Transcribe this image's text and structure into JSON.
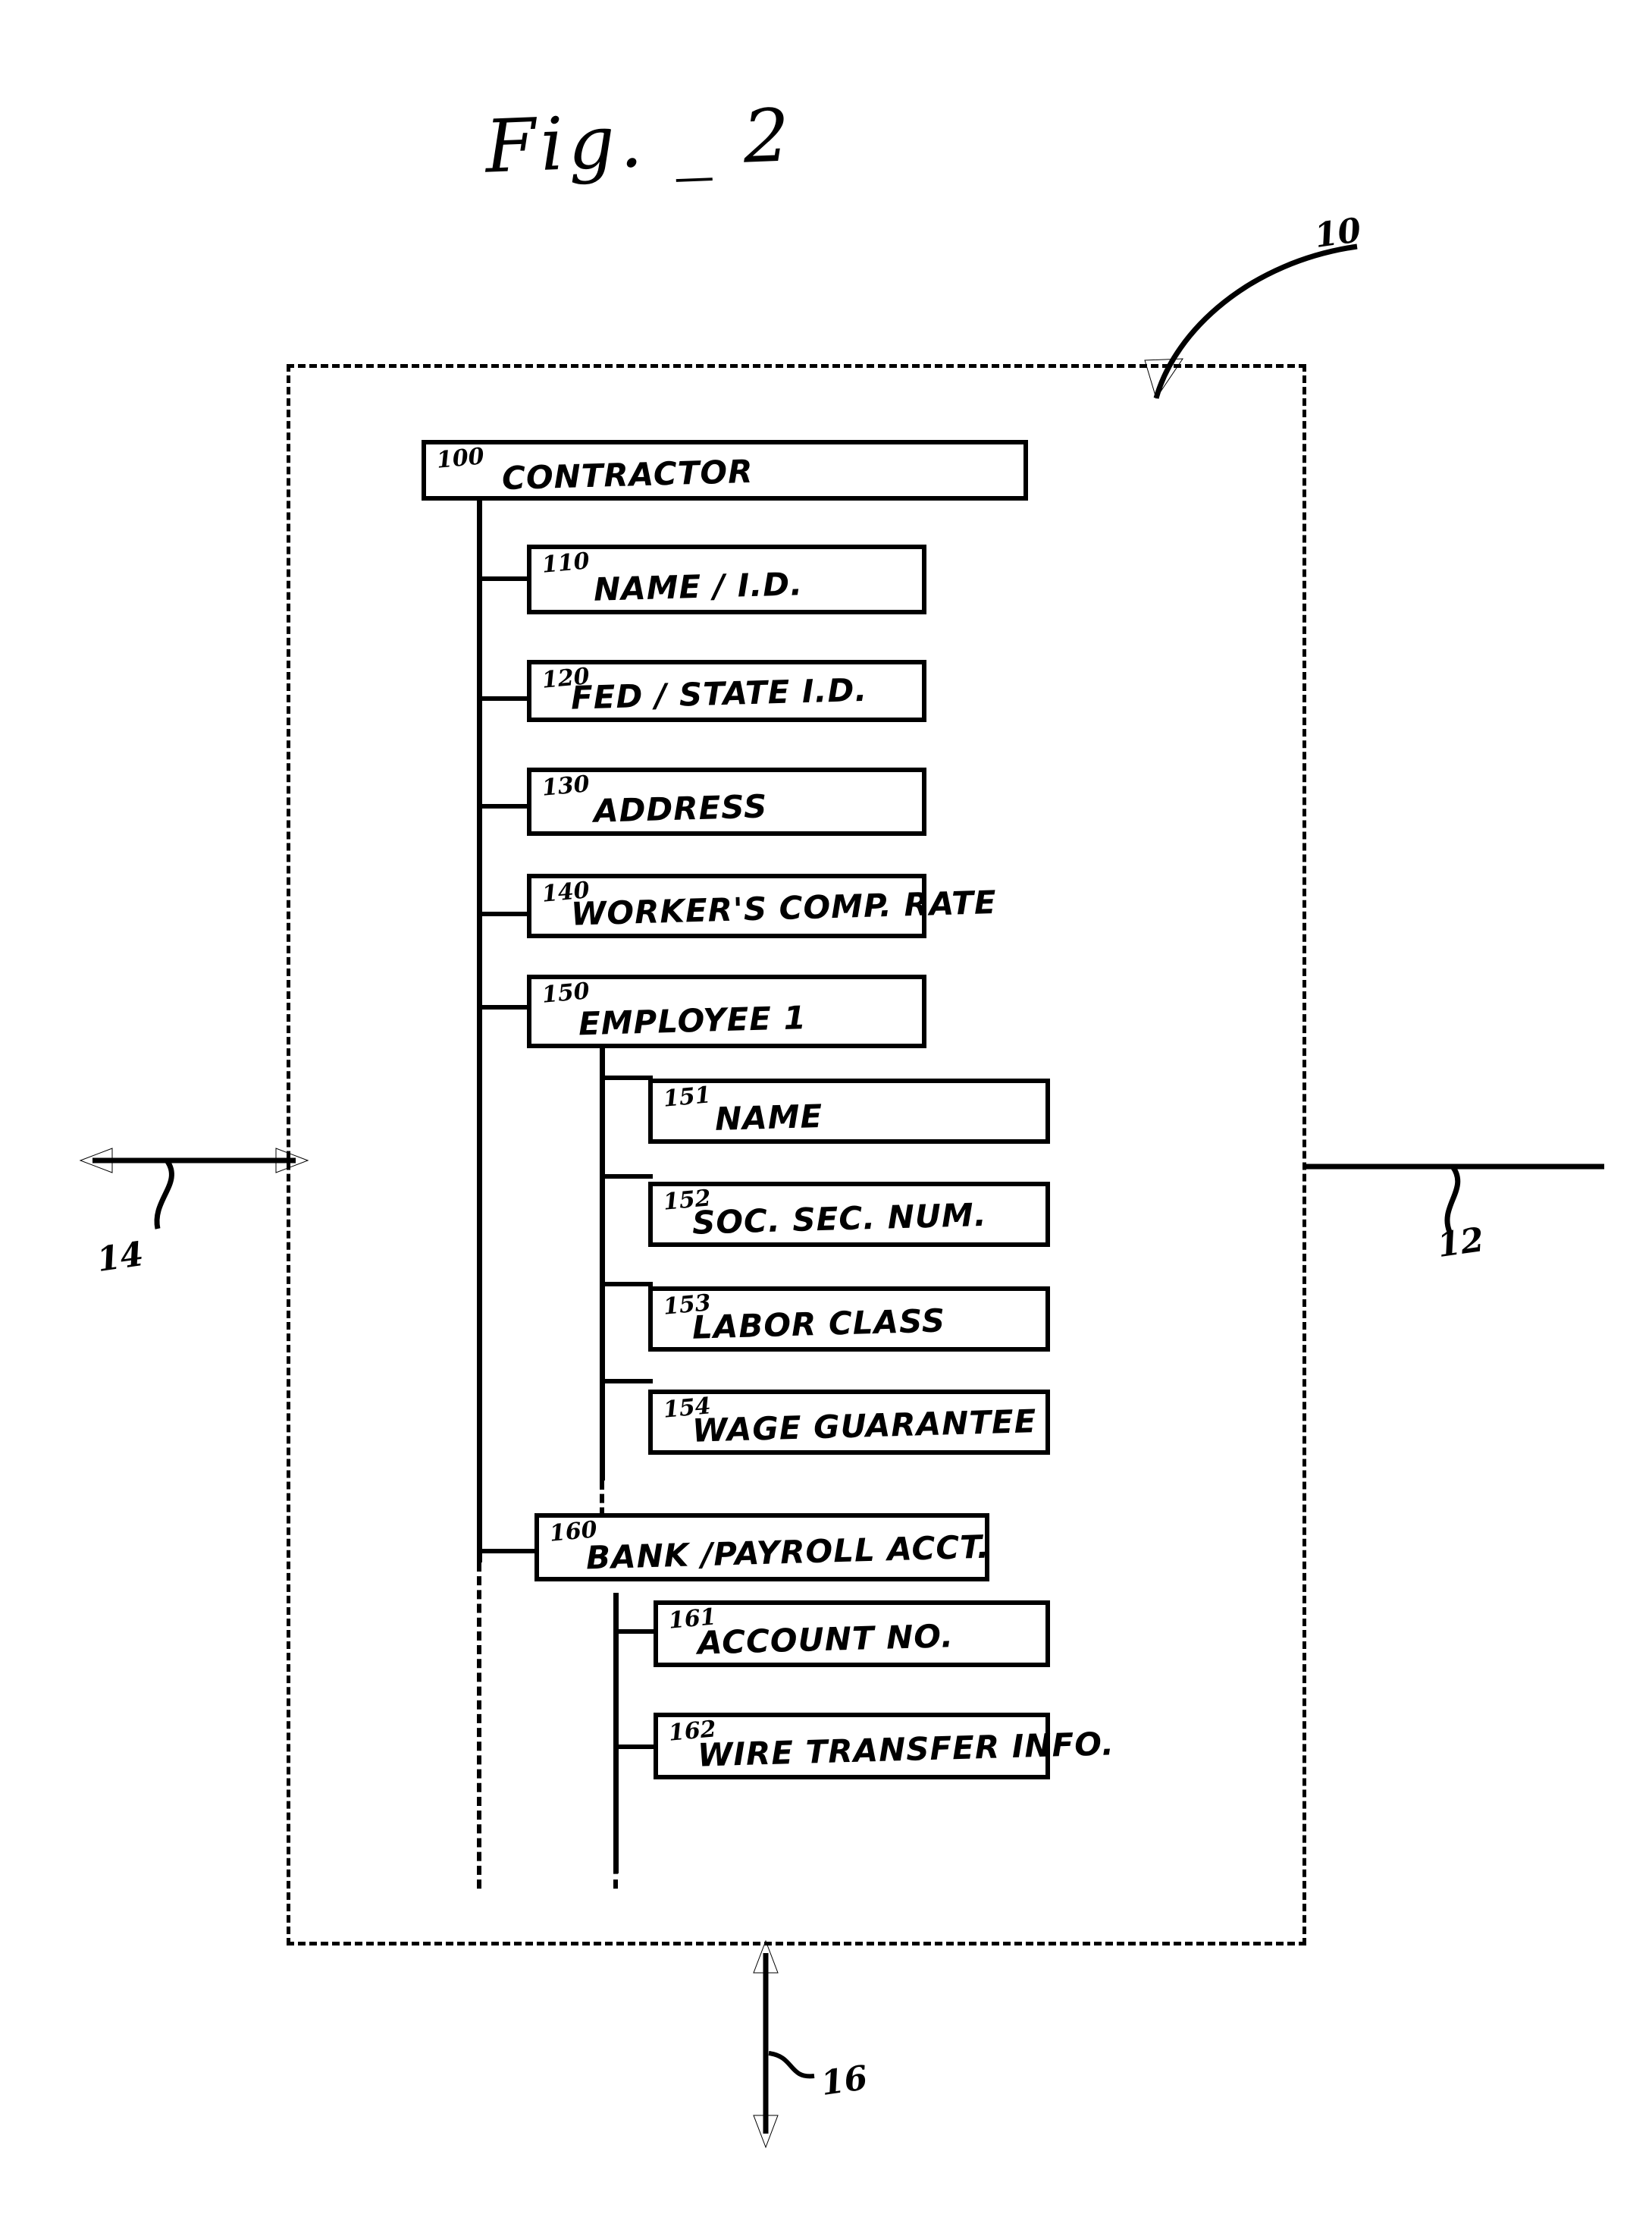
{
  "figure": {
    "title": "Fig. _ 2"
  },
  "boundary": {
    "name": "system-boundary",
    "style": "dashed"
  },
  "callouts": [
    {
      "id": "10",
      "label": "10",
      "position": "top-right",
      "leader": "curved-arrow-to-boundary-corner"
    },
    {
      "id": "12",
      "label": "12",
      "position": "right",
      "leader": "horizontal-line-right"
    },
    {
      "id": "14",
      "label": "14",
      "position": "left",
      "leader": "double-headed-horizontal-arrow"
    },
    {
      "id": "16",
      "label": "16",
      "position": "bottom",
      "leader": "double-headed-vertical-arrow"
    }
  ],
  "nodes": [
    {
      "ref": "100",
      "label": "CONTRACTOR",
      "level": 0
    },
    {
      "ref": "110",
      "label": "NAME / I.D.",
      "level": 1
    },
    {
      "ref": "120",
      "label": "FED / STATE  I.D.",
      "level": 1
    },
    {
      "ref": "130",
      "label": "ADDRESS",
      "level": 1
    },
    {
      "ref": "140",
      "label": "WORKER'S COMP. RATE",
      "level": 1
    },
    {
      "ref": "150",
      "label": "EMPLOYEE 1",
      "level": 1
    },
    {
      "ref": "151",
      "label": "NAME",
      "level": 2
    },
    {
      "ref": "152",
      "label": "SOC. SEC. NUM.",
      "level": 2
    },
    {
      "ref": "153",
      "label": "LABOR  CLASS",
      "level": 2
    },
    {
      "ref": "154",
      "label": "WAGE GUARANTEE",
      "level": 2
    },
    {
      "ref": "160",
      "label": "BANK /PAYROLL ACCT.",
      "level": 1
    },
    {
      "ref": "161",
      "label": "ACCOUNT NO.",
      "level": 2
    },
    {
      "ref": "162",
      "label": "WIRE TRANSFER INFO.",
      "level": 2
    }
  ],
  "colors": {
    "ink": "#000000",
    "paper": "#ffffff"
  }
}
